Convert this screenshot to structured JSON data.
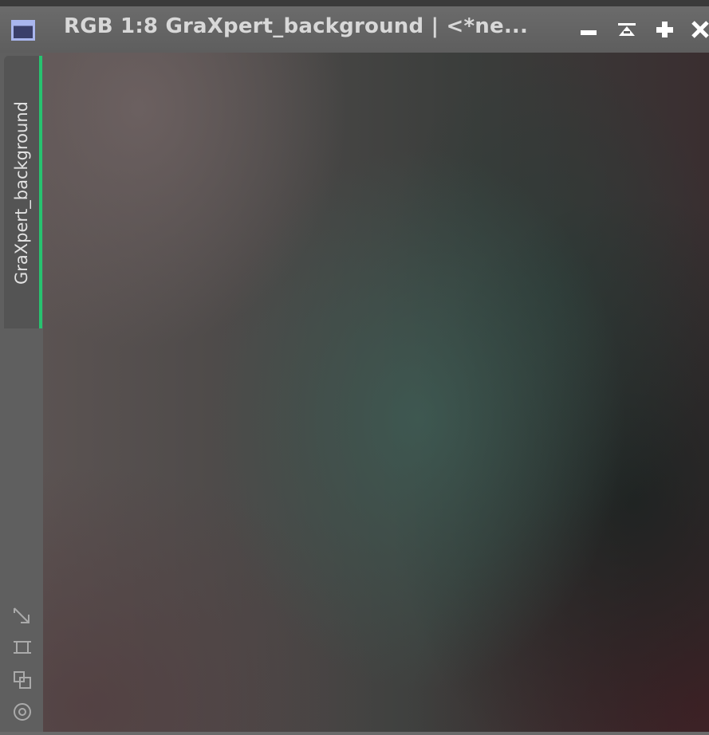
{
  "window": {
    "title": "RGB 1:8 GraXpert_background | <*ne...",
    "icon": "image-window-icon",
    "buttons": [
      {
        "name": "minimize-icon"
      },
      {
        "name": "shade-icon"
      },
      {
        "name": "maximize-icon"
      },
      {
        "name": "close-icon"
      }
    ]
  },
  "sidebar": {
    "tab_label": "GraXpert_background",
    "tab_accent_color": "#27c36f",
    "tools": [
      {
        "name": "zoom-to-fit-icon"
      },
      {
        "name": "fit-view-icon"
      },
      {
        "name": "clone-icon"
      },
      {
        "name": "target-icon"
      }
    ]
  },
  "colors": {
    "titlebar": "#656565",
    "title_text": "#d8d8d8",
    "accent": "#27c36f"
  }
}
